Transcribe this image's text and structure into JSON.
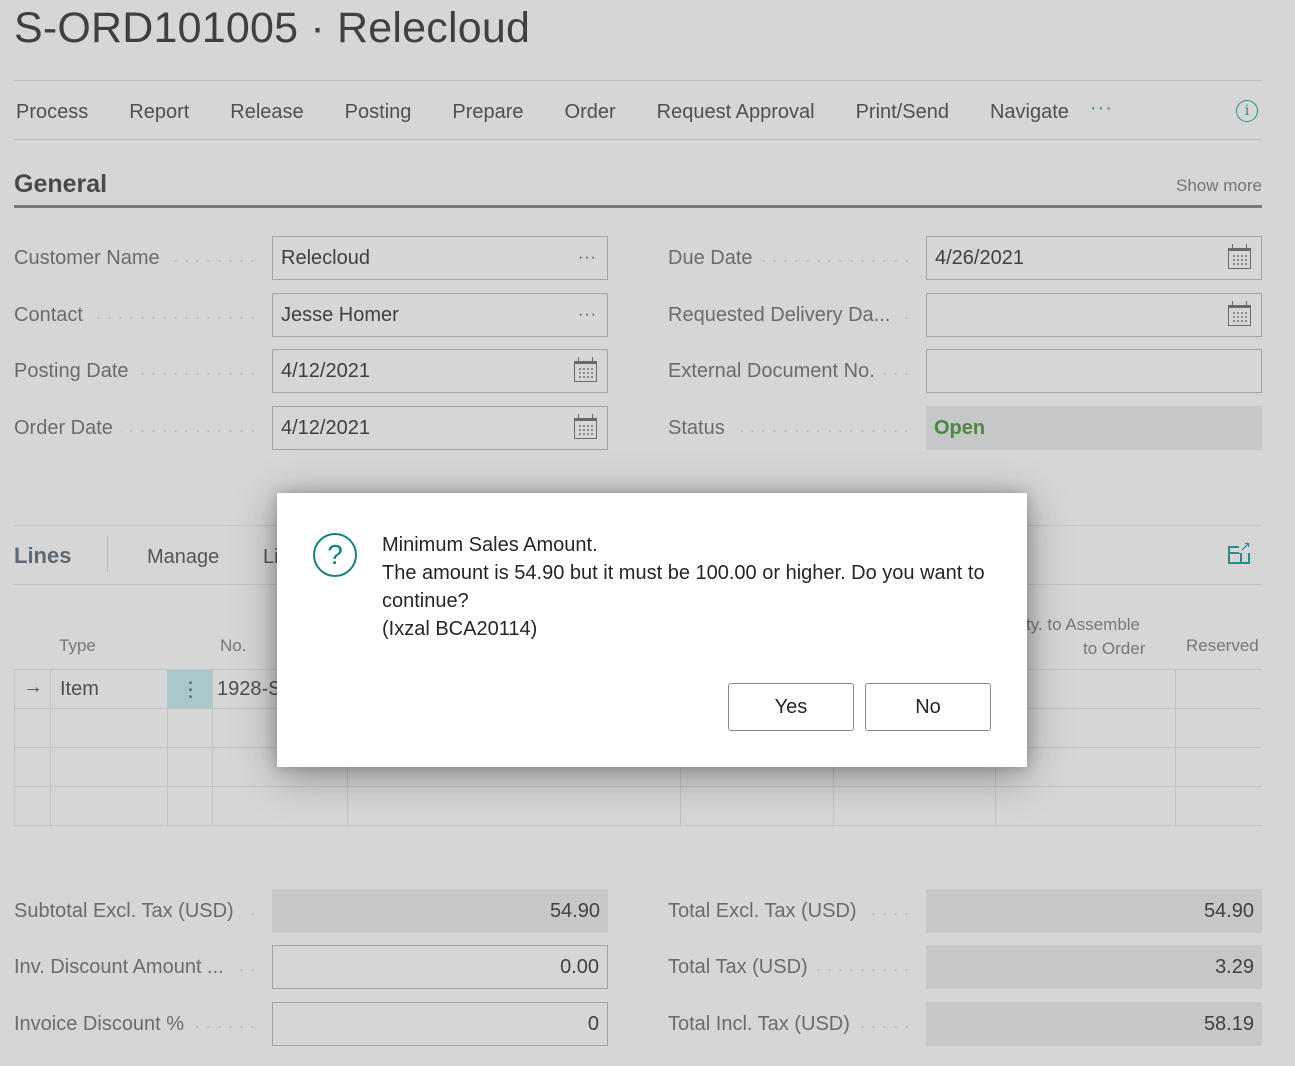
{
  "header": {
    "title": "S-ORD101005 · Relecloud"
  },
  "actions": [
    "Process",
    "Report",
    "Release",
    "Posting",
    "Prepare",
    "Order",
    "Request Approval",
    "Print/Send",
    "Navigate"
  ],
  "actions_more": "···",
  "general": {
    "title": "General",
    "show_more": "Show more",
    "left_fields": [
      {
        "label": "Customer Name",
        "value": "Relecloud",
        "control": "lookup"
      },
      {
        "label": "Contact",
        "value": "Jesse Homer",
        "control": "lookup"
      },
      {
        "label": "Posting Date",
        "value": "4/12/2021",
        "control": "date"
      },
      {
        "label": "Order Date",
        "value": "4/12/2021",
        "control": "date"
      }
    ],
    "right_fields": [
      {
        "label": "Due Date",
        "value": "4/26/2021",
        "control": "date"
      },
      {
        "label": "Requested Delivery Da...",
        "value": "",
        "control": "date"
      },
      {
        "label": "External Document No.",
        "value": "",
        "control": "text"
      },
      {
        "label": "Status",
        "value": "Open",
        "control": "readonly"
      }
    ],
    "status_color": "#4b8a44"
  },
  "lines": {
    "title": "Lines",
    "tabs": [
      "Manage",
      "Li"
    ],
    "columns": [
      "Type",
      "No.",
      "Qty. to Assemble to Order",
      "Reserved"
    ],
    "col_qty_line1": "ty. to Assemble",
    "col_qty_line2": "to Order",
    "rows": [
      {
        "type": "Item",
        "no": "1928-S"
      }
    ]
  },
  "totals": {
    "left": [
      {
        "label": "Subtotal Excl. Tax (USD)",
        "value": "54.90",
        "editable": false
      },
      {
        "label": "Inv. Discount Amount ...",
        "value": "0.00",
        "editable": true
      },
      {
        "label": "Invoice Discount %",
        "value": "0",
        "editable": true
      }
    ],
    "right": [
      {
        "label": "Total Excl. Tax (USD)",
        "value": "54.90"
      },
      {
        "label": "Total Tax (USD)",
        "value": "3.29"
      },
      {
        "label": "Total Incl. Tax (USD)",
        "value": "58.19"
      }
    ]
  },
  "dialog": {
    "icon": "?",
    "line1": "Minimum Sales Amount.",
    "line2": "The amount is 54.90 but it must be 100.00 or higher. Do you want to continue?",
    "line3": "(Ixzal BCA20114)",
    "yes_label": "Yes",
    "no_label": "No"
  },
  "colors": {
    "accent": "#14817f",
    "background": "#d6d6d6",
    "readonly_field": "#c6c7c8",
    "selected_cell": "#a9c8cb"
  }
}
